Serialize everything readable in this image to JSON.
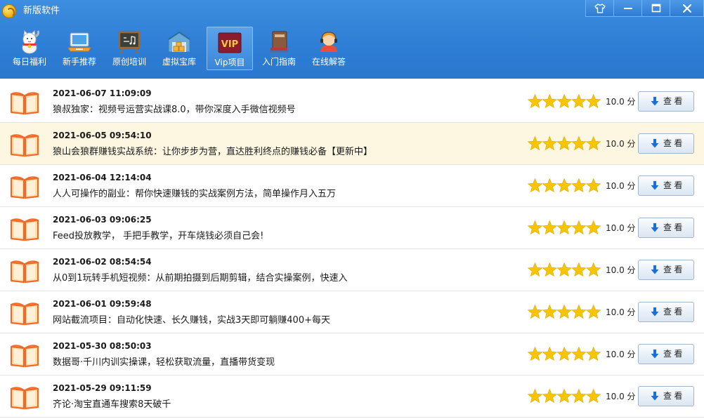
{
  "window": {
    "title": "新版软件",
    "logo_icon": "coin-logo-icon",
    "controls": [
      {
        "name": "skin-button",
        "icon": "shirt-icon"
      },
      {
        "name": "minimize-button",
        "icon": "minimize-icon"
      },
      {
        "name": "maximize-button",
        "icon": "maximize-icon"
      },
      {
        "name": "close-button",
        "icon": "close-icon"
      }
    ]
  },
  "nav": {
    "active_index": 4,
    "items": [
      {
        "label": "每日福利",
        "icon": "lucky-cat-icon"
      },
      {
        "label": "新手推荐",
        "icon": "laptop-icon"
      },
      {
        "label": "原创培训",
        "icon": "chalkboard-icon"
      },
      {
        "label": "虚拟宝库",
        "icon": "warehouse-icon"
      },
      {
        "label": "Vip项目",
        "icon": "vip-badge-icon",
        "badge_text": "VIP"
      },
      {
        "label": "入门指南",
        "icon": "books-icon"
      },
      {
        "label": "在线解答",
        "icon": "support-agent-icon"
      }
    ]
  },
  "list": {
    "highlight_index": 1,
    "rating_max": 5,
    "items": [
      {
        "date": "2021-06-07 11:09:09",
        "title": "狼叔独家：视频号运营实战课8.0，带你深度入手微信视频号",
        "rating": 5,
        "score": "10.0 分",
        "button": "查 看"
      },
      {
        "date": "2021-06-05 09:54:10",
        "title": "狼山会狼群赚钱实战系统：让你步步为营，直达胜利终点的赚钱必备【更新中】",
        "rating": 5,
        "score": "10.0 分",
        "button": "查 看"
      },
      {
        "date": "2021-06-04 12:14:04",
        "title": "人人可操作的副业：帮你快速赚钱的实战案例方法，简单操作月入五万",
        "rating": 5,
        "score": "10.0 分",
        "button": "查 看"
      },
      {
        "date": "2021-06-03 09:06:25",
        "title": "Feed投放教学， 手把手教学，开车烧钱必须自己会!",
        "rating": 5,
        "score": "10.0 分",
        "button": "查 看"
      },
      {
        "date": "2021-06-02 08:54:54",
        "title": "从0到1玩转手机短视频：从前期拍摄到后期剪辑，结合实操案例，快速入",
        "rating": 5,
        "score": "10.0 分",
        "button": "查 看"
      },
      {
        "date": "2021-06-01 09:59:48",
        "title": "网站截流项目：自动化快速、长久赚钱，实战3天即可躺赚400+每天",
        "rating": 5,
        "score": "10.0 分",
        "button": "查 看"
      },
      {
        "date": "2021-05-30 08:50:03",
        "title": "数据哥·千川内训实操课，轻松获取流量，直播带货变现",
        "rating": 5,
        "score": "10.0 分",
        "button": "查 看"
      },
      {
        "date": "2021-05-29 09:11:59",
        "title": "齐论·淘宝直通车搜索8天破千",
        "rating": 5,
        "score": "10.0 分",
        "button": "查 看"
      }
    ],
    "item_icon": "open-book-icon",
    "button_icon": "download-arrow-icon"
  },
  "colors": {
    "header_blue": "#2f7fd6",
    "star_yellow": "#f7c600",
    "highlight_row": "#fdf7e2",
    "book_orange": "#f06a2a",
    "arrow_blue": "#1a6fd1"
  }
}
